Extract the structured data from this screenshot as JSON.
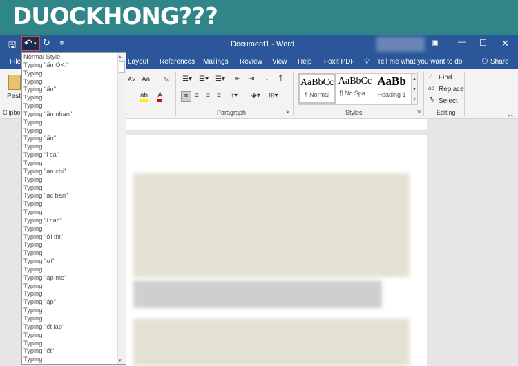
{
  "banner": {
    "text": "DUOCKHONG???"
  },
  "titlebar": {
    "title": "Document1 - Word",
    "buttons": [
      "ribbon-display-options",
      "minimize",
      "maximize",
      "close"
    ]
  },
  "qat": {
    "save": "save-icon",
    "undo": "undo-icon",
    "redo": "redo-icon",
    "customize": "customize-icon"
  },
  "tabs": {
    "file": "File",
    "layout": "Layout",
    "references": "References",
    "mailings": "Mailings",
    "review": "Review",
    "view": "View",
    "help": "Help",
    "foxit": "Foxit PDF",
    "tell": "Tell me what you want to do",
    "share": "Share"
  },
  "ribbon": {
    "paste": "Paste",
    "clipboard": "Clipbo",
    "paragraph": "Paragraph",
    "styles": "Styles",
    "editing": "Editing",
    "style_items": [
      {
        "preview": "AaBbCc",
        "name": "¶ Normal"
      },
      {
        "preview": "AaBbCc",
        "name": "¶ No Spa..."
      },
      {
        "preview": "AaBb",
        "name": "Heading 1"
      }
    ],
    "find": "Find",
    "replace": "Replace",
    "select": "Select",
    "font_case": "Aa"
  },
  "undo_list": [
    "Normal Style",
    "Typing \"ấn OK.\"",
    "Typing",
    "Typing",
    "Typing \"ấn\"",
    "Typing",
    "Typing",
    "Typing \"ần nhan\"",
    "Typing",
    "Typing",
    "Typing \"ấn\"",
    "Typing",
    "Typing \"ỉ ca\"",
    "Typing",
    "Typing \"ạn chi\"",
    "Typing",
    "Typing",
    "Typing \"ác ban\"",
    "Typing",
    "Typing",
    "Typing \"ỉ cac\"",
    "Typing",
    "Typing \"ởi thi\"",
    "Typing",
    "Typing",
    "Typing \"ơi\"",
    "Typing",
    "Typing \"ập mo\"",
    "Typing",
    "Typing",
    "Typing \"ập\"",
    "Typing",
    "Typing",
    "Typing \"ết lap\"",
    "Typing",
    "Typing",
    "Typing \"ết\"",
    "Typing"
  ],
  "colors": {
    "word_blue": "#2b579a",
    "banner": "#2f8587",
    "undo_highlight": "#e0474c"
  }
}
